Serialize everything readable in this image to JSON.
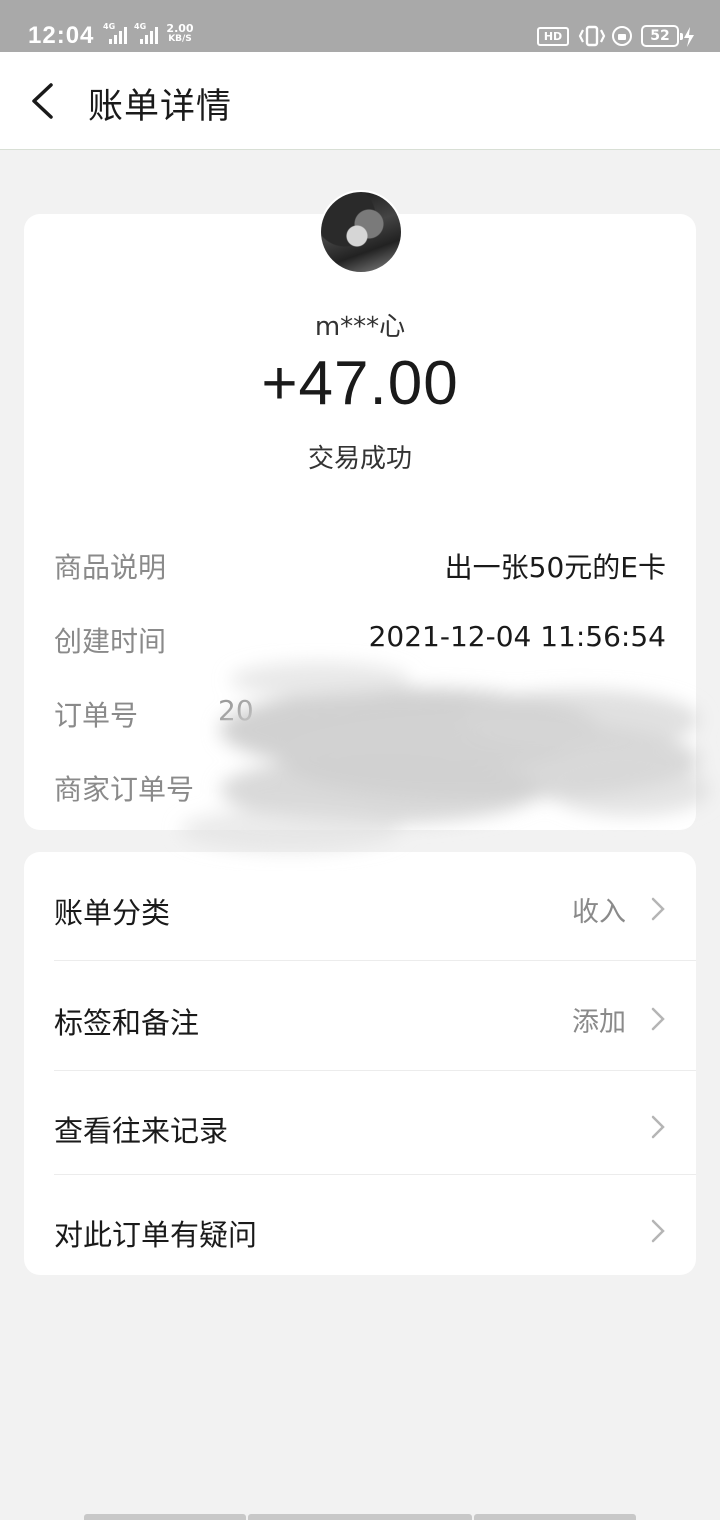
{
  "status_bar": {
    "time": "12:04",
    "network_1": "4G",
    "network_2": "4G",
    "speed_value": "2.00",
    "speed_unit": "KB/S",
    "hd_label": "HD",
    "battery_level": "52"
  },
  "header": {
    "title": "账单详情"
  },
  "summary": {
    "counterparty": "m***心",
    "amount": "+47.00",
    "status": "交易成功"
  },
  "details": [
    {
      "label": "商品说明",
      "value": "出一张50元的E卡"
    },
    {
      "label": "创建时间",
      "value": "2021-12-04 11:56:54"
    },
    {
      "label": "订单号",
      "value": "20"
    },
    {
      "label": "商家订单号",
      "value": ""
    }
  ],
  "menu": [
    {
      "label": "账单分类",
      "value": "收入"
    },
    {
      "label": "标签和备注",
      "value": "添加"
    },
    {
      "label": "查看往来记录",
      "value": ""
    },
    {
      "label": "对此订单有疑问",
      "value": ""
    }
  ],
  "colors": {
    "status_bar": "#a9a9a9",
    "background": "#f2f2f2",
    "card": "#ffffff",
    "label_gray": "#8a8a8a"
  }
}
